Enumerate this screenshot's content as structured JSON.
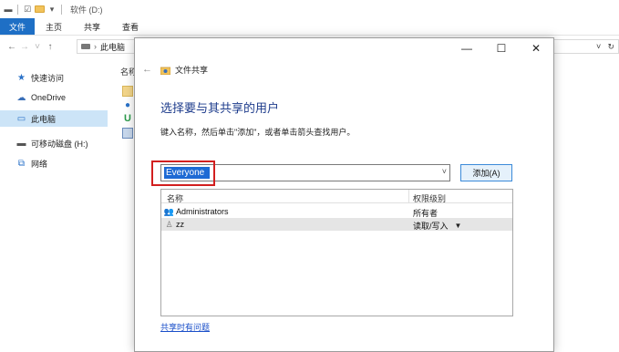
{
  "explorer": {
    "title": "软件 (D:)",
    "ribbon_tabs": [
      "文件",
      "主页",
      "共享",
      "查看"
    ],
    "breadcrumb": "此电脑",
    "column_header": "名称",
    "sidebar": [
      {
        "label": "快速访问",
        "icon": "star-icon"
      },
      {
        "label": "OneDrive",
        "icon": "cloud-icon"
      },
      {
        "label": "此电脑",
        "icon": "computer-icon",
        "selected": true
      },
      {
        "label": "可移动磁盘 (H:)",
        "icon": "drive-icon"
      },
      {
        "label": "网络",
        "icon": "network-icon"
      }
    ]
  },
  "dialog": {
    "title": "文件共享",
    "heading": "选择要与其共享的用户",
    "description": "键入名称，然后单击\"添加\"，或者单击箭头查找用户。",
    "input_value": "Everyone",
    "add_button": "添加(A)",
    "table": {
      "headers": [
        "名称",
        "权限级别"
      ],
      "rows": [
        {
          "name": "Administrators",
          "permission": "所有者"
        },
        {
          "name": "zz",
          "permission": "读取/写入"
        }
      ]
    },
    "help_link": "共享时有问题"
  },
  "colors": {
    "accent": "#1e6fc5",
    "selection": "#cce4f7",
    "highlight_red": "#d21f1f",
    "heading_blue": "#1e3c8c"
  }
}
